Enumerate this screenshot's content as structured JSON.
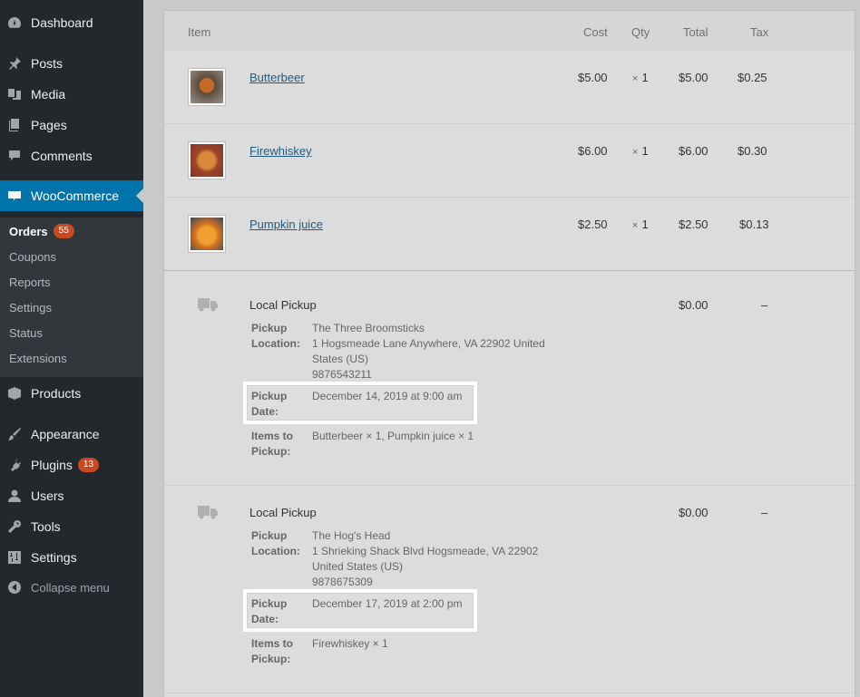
{
  "sidebar": {
    "menu": [
      {
        "label": "Dashboard",
        "icon": "dashboard-icon"
      },
      {
        "label": "Posts",
        "icon": "pin-icon"
      },
      {
        "label": "Media",
        "icon": "media-icon"
      },
      {
        "label": "Pages",
        "icon": "pages-icon"
      },
      {
        "label": "Comments",
        "icon": "comments-icon"
      },
      {
        "label": "WooCommerce",
        "icon": "woo-icon"
      },
      {
        "label": "Products",
        "icon": "box-icon"
      },
      {
        "label": "Appearance",
        "icon": "brush-icon"
      },
      {
        "label": "Plugins",
        "icon": "plugin-icon",
        "badge": "13"
      },
      {
        "label": "Users",
        "icon": "user-icon"
      },
      {
        "label": "Tools",
        "icon": "wrench-icon"
      },
      {
        "label": "Settings",
        "icon": "settings-icon"
      }
    ],
    "submenu": [
      {
        "label": "Orders",
        "badge": "55"
      },
      {
        "label": "Coupons"
      },
      {
        "label": "Reports"
      },
      {
        "label": "Settings"
      },
      {
        "label": "Status"
      },
      {
        "label": "Extensions"
      }
    ],
    "collapse_label": "Collapse menu"
  },
  "table": {
    "headers": {
      "item": "Item",
      "cost": "Cost",
      "qty": "Qty",
      "total": "Total",
      "tax": "Tax"
    },
    "items": [
      {
        "name": "Butterbeer",
        "cost": "$5.00",
        "qty_prefix": "×",
        "qty": "1",
        "total": "$5.00",
        "tax": "$0.25"
      },
      {
        "name": "Firewhiskey",
        "cost": "$6.00",
        "qty_prefix": "×",
        "qty": "1",
        "total": "$6.00",
        "tax": "$0.30"
      },
      {
        "name": "Pumpkin juice",
        "cost": "$2.50",
        "qty_prefix": "×",
        "qty": "1",
        "total": "$2.50",
        "tax": "$0.13"
      }
    ],
    "shipping": [
      {
        "title": "Local Pickup",
        "total": "$0.00",
        "tax": "–",
        "location_label_1": "Pickup",
        "location_label_2": "Location:",
        "location_lines": [
          "The Three Broomsticks",
          "1 Hogsmeade Lane Anywhere, VA 22902 United",
          "States (US)",
          "9876543211"
        ],
        "date_label_1": "Pickup",
        "date_label_2": "Date:",
        "date": "December 14, 2019 at 9:00 am",
        "items_label_1": "Items to",
        "items_label_2": "Pickup:",
        "items": "Butterbeer × 1, Pumpkin juice × 1"
      },
      {
        "title": "Local Pickup",
        "total": "$0.00",
        "tax": "–",
        "location_label_1": "Pickup",
        "location_label_2": "Location:",
        "location_lines": [
          "The Hog's Head",
          "1 Shrieking Shack Blvd Hogsmeade, VA 22902",
          "United States (US)",
          "9878675309"
        ],
        "date_label_1": "Pickup",
        "date_label_2": "Date:",
        "date": "December 17, 2019 at 2:00 pm",
        "items_label_1": "Items to",
        "items_label_2": "Pickup:",
        "items": "Firewhiskey × 1"
      }
    ]
  },
  "colors": {
    "sidebar_bg": "#23282d",
    "active_bg": "#0073aa",
    "badge_bg": "#ca4a1f",
    "link": "#1f5b85"
  }
}
